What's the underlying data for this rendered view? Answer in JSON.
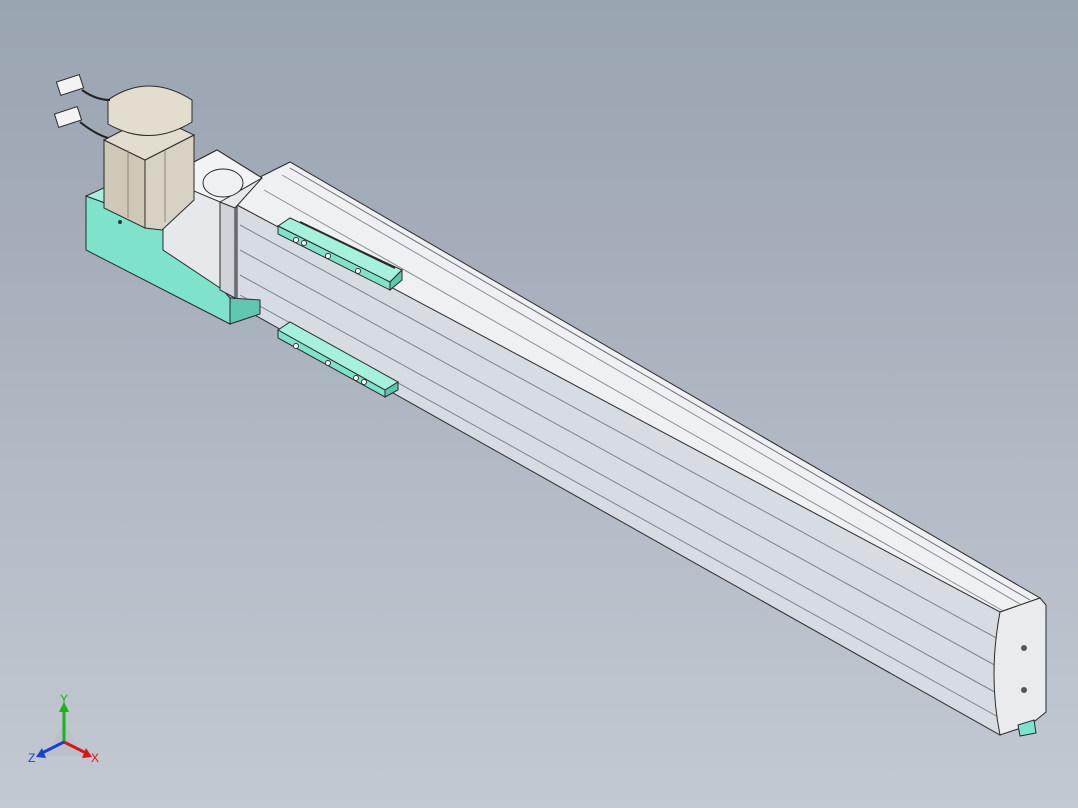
{
  "triad": {
    "x_label": "X",
    "y_label": "Y",
    "z_label": "Z"
  },
  "colors": {
    "background_top": "#9aa5b2",
    "background_bottom": "#c3c9d2",
    "rail_body": "#e4e7ec",
    "rail_shadow": "#c9ced6",
    "bracket": "#7fe3cc",
    "bracket_dark": "#5fc7b0",
    "motor": "#d8d2c4",
    "coupling": "#e6e8ec",
    "axis_x": "#d11a1a",
    "axis_y": "#18b418",
    "axis_z": "#1a3fd1"
  },
  "model": {
    "parts": [
      "servo-motor",
      "motor-connector-upper",
      "motor-connector-lower",
      "motor-mount-bracket",
      "coupling-housing",
      "linear-rail-body",
      "slider-plate-upper",
      "slider-plate-lower",
      "end-cap"
    ]
  }
}
